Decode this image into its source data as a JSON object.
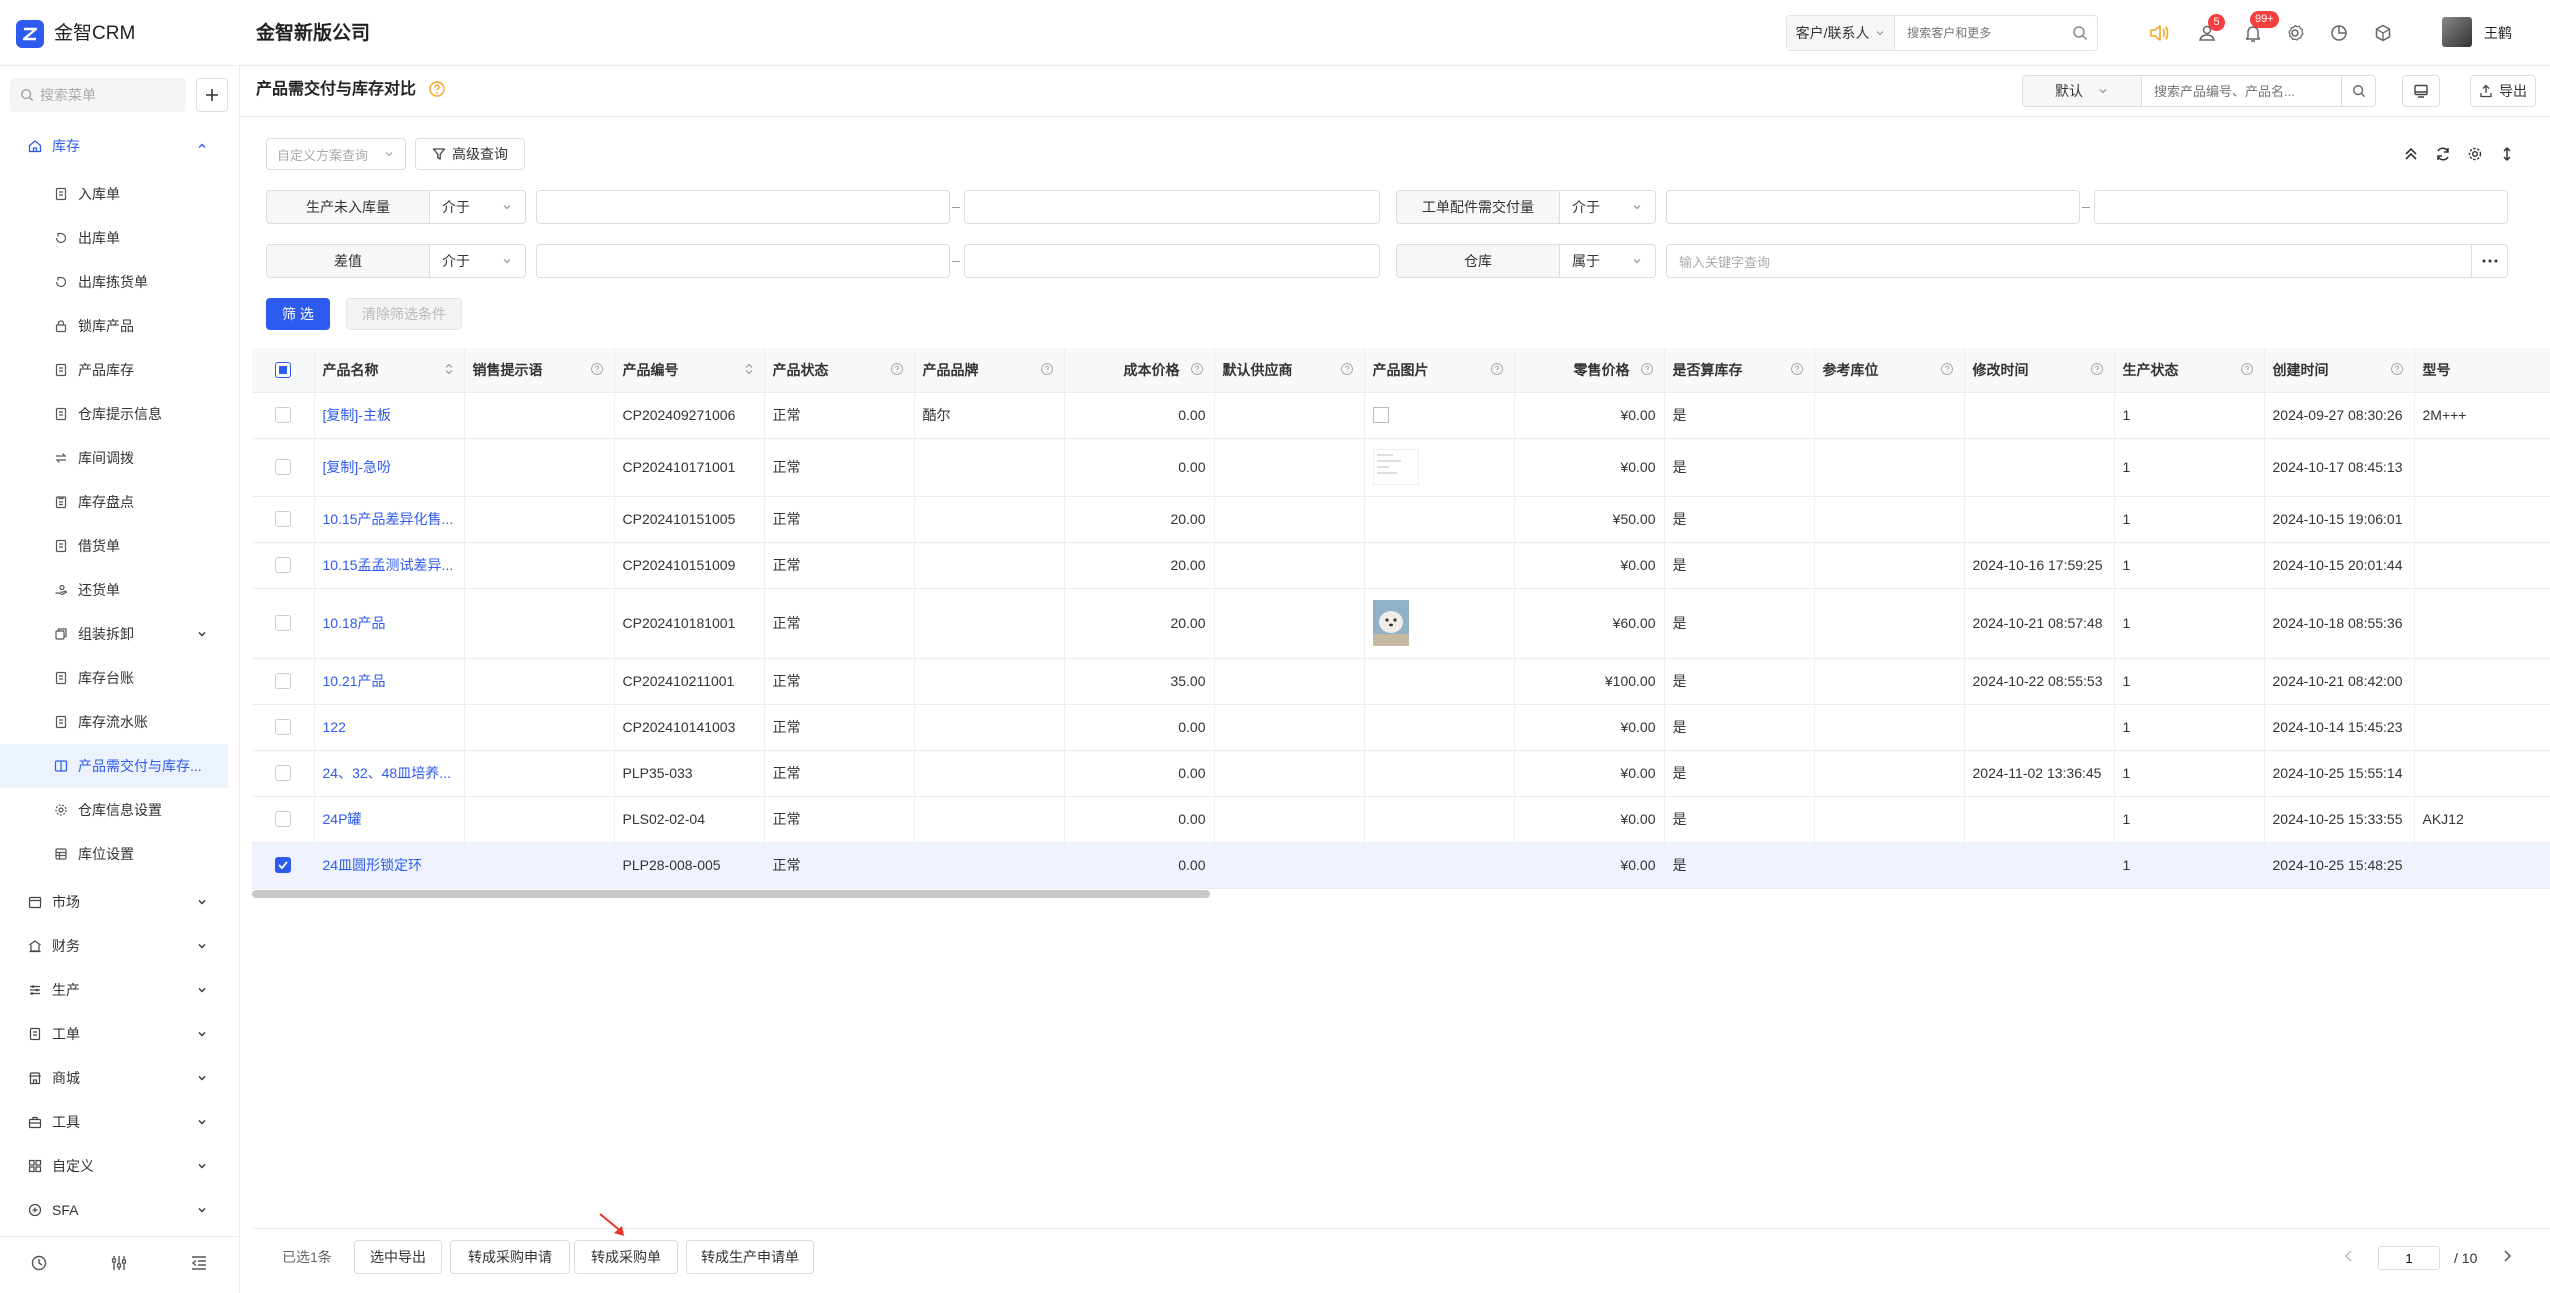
{
  "app": {
    "name": "金智CRM",
    "company": "金智新版公司"
  },
  "topbar": {
    "search_type": "客户/联系人",
    "search_placeholder": "搜索客户和更多",
    "badges": {
      "tasks": "5",
      "notifications": "99+"
    },
    "user_name": "王鹤"
  },
  "sidebar": {
    "search_placeholder": "搜索菜单",
    "groups": [
      {
        "label": "库存",
        "expanded": true
      },
      {
        "label": "市场"
      },
      {
        "label": "财务"
      },
      {
        "label": "生产"
      },
      {
        "label": "工单"
      },
      {
        "label": "商城"
      },
      {
        "label": "工具"
      },
      {
        "label": "自定义"
      },
      {
        "label": "SFA"
      }
    ],
    "items": [
      {
        "label": "入库单"
      },
      {
        "label": "出库单"
      },
      {
        "label": "出库拣货单"
      },
      {
        "label": "锁库产品"
      },
      {
        "label": "产品库存"
      },
      {
        "label": "仓库提示信息"
      },
      {
        "label": "库间调拨"
      },
      {
        "label": "库存盘点"
      },
      {
        "label": "借货单"
      },
      {
        "label": "还货单"
      },
      {
        "label": "组装拆卸"
      },
      {
        "label": "库存台账"
      },
      {
        "label": "库存流水账"
      },
      {
        "label": "产品需交付与库存..."
      },
      {
        "label": "仓库信息设置"
      },
      {
        "label": "库位设置"
      }
    ]
  },
  "page": {
    "title": "产品需交付与库存对比",
    "view": "默认",
    "search_placeholder": "搜索产品编号、产品名...",
    "export_label": "导出"
  },
  "filters": {
    "custom_scheme": "自定义方案查询",
    "advanced": "高级查询",
    "rows": [
      {
        "label": "生产未入库量",
        "op": "介于"
      },
      {
        "label": "工单配件需交付量",
        "op": "介于"
      },
      {
        "label": "差值",
        "op": "介于"
      },
      {
        "label": "仓库",
        "op": "属于",
        "placeholder": "输入关键字查询"
      }
    ],
    "apply": "筛 选",
    "clear": "清除筛选条件"
  },
  "table": {
    "columns": [
      "产品名称",
      "销售提示语",
      "产品编号",
      "产品状态",
      "产品品牌",
      "成本价格",
      "默认供应商",
      "产品图片",
      "零售价格",
      "是否算库存",
      "参考库位",
      "修改时间",
      "生产状态",
      "创建时间",
      "型号"
    ],
    "rows": [
      {
        "name": "[复制]-主板",
        "tip": "",
        "code": "CP202409271006",
        "status": "正常",
        "brand": "酷尔",
        "cost": "0.00",
        "supplier": "",
        "img": "broken",
        "price": "¥0.00",
        "stock": "是",
        "loc": "",
        "mtime": "",
        "pstatus": "1",
        "ctime": "2024-09-27 08:30:26",
        "model": "2M+++"
      },
      {
        "name": "[复制]-急吩",
        "tip": "",
        "code": "CP202410171001",
        "status": "正常",
        "brand": "",
        "cost": "0.00",
        "supplier": "",
        "img": "doc",
        "price": "¥0.00",
        "stock": "是",
        "loc": "",
        "mtime": "",
        "pstatus": "1",
        "ctime": "2024-10-17 08:45:13",
        "model": ""
      },
      {
        "name": "10.15产品差异化售...",
        "tip": "",
        "code": "CP202410151005",
        "status": "正常",
        "brand": "",
        "cost": "20.00",
        "supplier": "",
        "img": "",
        "price": "¥50.00",
        "stock": "是",
        "loc": "",
        "mtime": "",
        "pstatus": "1",
        "ctime": "2024-10-15 19:06:01",
        "model": ""
      },
      {
        "name": "10.15孟孟测试差异...",
        "tip": "",
        "code": "CP202410151009",
        "status": "正常",
        "brand": "",
        "cost": "20.00",
        "supplier": "",
        "img": "",
        "price": "¥0.00",
        "stock": "是",
        "loc": "",
        "mtime": "2024-10-16 17:59:25",
        "pstatus": "1",
        "ctime": "2024-10-15 20:01:44",
        "model": ""
      },
      {
        "name": "10.18产品",
        "tip": "",
        "code": "CP202410181001",
        "status": "正常",
        "brand": "",
        "cost": "20.00",
        "supplier": "",
        "img": "photo",
        "price": "¥60.00",
        "stock": "是",
        "loc": "",
        "mtime": "2024-10-21 08:57:48",
        "pstatus": "1",
        "ctime": "2024-10-18 08:55:36",
        "model": ""
      },
      {
        "name": "10.21产品",
        "tip": "",
        "code": "CP202410211001",
        "status": "正常",
        "brand": "",
        "cost": "35.00",
        "supplier": "",
        "img": "",
        "price": "¥100.00",
        "stock": "是",
        "loc": "",
        "mtime": "2024-10-22 08:55:53",
        "pstatus": "1",
        "ctime": "2024-10-21 08:42:00",
        "model": ""
      },
      {
        "name": "122",
        "tip": "",
        "code": "CP202410141003",
        "status": "正常",
        "brand": "",
        "cost": "0.00",
        "supplier": "",
        "img": "",
        "price": "¥0.00",
        "stock": "是",
        "loc": "",
        "mtime": "",
        "pstatus": "1",
        "ctime": "2024-10-14 15:45:23",
        "model": ""
      },
      {
        "name": "24、32、48皿培养...",
        "tip": "",
        "code": "PLP35-033",
        "status": "正常",
        "brand": "",
        "cost": "0.00",
        "supplier": "",
        "img": "",
        "price": "¥0.00",
        "stock": "是",
        "loc": "",
        "mtime": "2024-11-02 13:36:45",
        "pstatus": "1",
        "ctime": "2024-10-25 15:55:14",
        "model": ""
      },
      {
        "name": "24P罐",
        "tip": "",
        "code": "PLS02-02-04",
        "status": "正常",
        "brand": "",
        "cost": "0.00",
        "supplier": "",
        "img": "",
        "price": "¥0.00",
        "stock": "是",
        "loc": "",
        "mtime": "",
        "pstatus": "1",
        "ctime": "2024-10-25 15:33:55",
        "model": "AKJ12"
      },
      {
        "name": "24皿圆形锁定环",
        "tip": "",
        "code": "PLP28-008-005",
        "status": "正常",
        "brand": "",
        "cost": "0.00",
        "supplier": "",
        "img": "",
        "price": "¥0.00",
        "stock": "是",
        "loc": "",
        "mtime": "",
        "pstatus": "1",
        "ctime": "2024-10-25 15:48:25",
        "model": "",
        "selected": true
      }
    ]
  },
  "footer": {
    "selected": "已选1条",
    "actions": [
      "选中导出",
      "转成采购申请",
      "转成采购单",
      "转成生产申请单"
    ],
    "page": "1",
    "total": "/ 10"
  },
  "colors": {
    "accent": "#2d5bf0",
    "badge": "#f53e3e",
    "warning": "#f5a623"
  }
}
